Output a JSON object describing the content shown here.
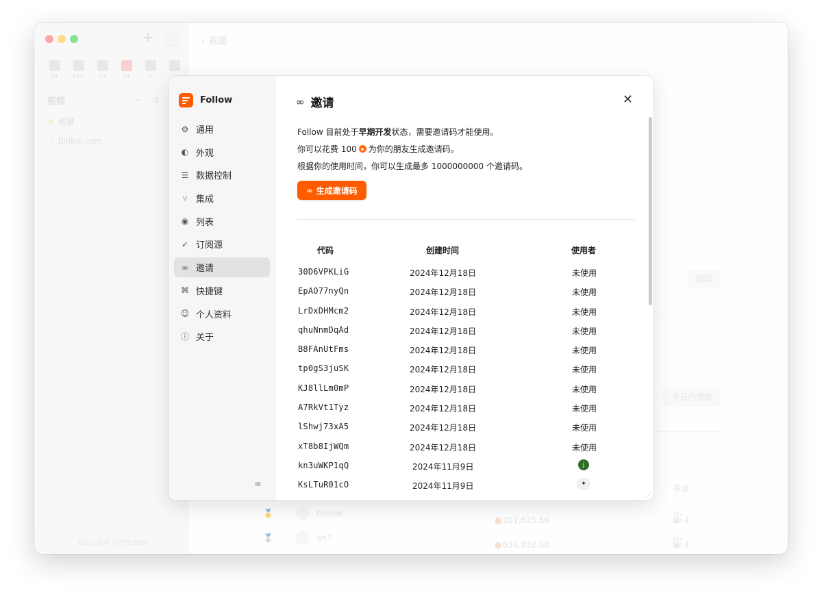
{
  "app": {
    "new_button": "+",
    "categories": [
      {
        "icon": "article-icon",
        "count": "34"
      },
      {
        "icon": "twitter-icon",
        "count": "99+"
      },
      {
        "icon": "picture-icon",
        "count": "17"
      },
      {
        "icon": "video-icon",
        "count": "11"
      },
      {
        "icon": "microphone-icon",
        "count": "0"
      },
      {
        "icon": "megaphone-icon",
        "count": ""
      }
    ],
    "section_title": "视频",
    "section_tools": "⇤ ⇶",
    "favorites": "收藏",
    "feed_group": "Bilibili.com",
    "feed_chevron": "›",
    "version": "Beta 版本 (0732308)"
  },
  "background": {
    "back_label": "返回",
    "withdraw": "提现",
    "claimed_today": "今日已领取",
    "grade_header": "等级",
    "leaderboard": [
      {
        "medal": "🥇",
        "name": "Follow",
        "amount": "1,101,625.56",
        "level": "Lv.4",
        "mult": "36x"
      },
      {
        "medal": "🥈",
        "name": "an7",
        "amount": "1,036,832.60",
        "level": "Lv.4",
        "mult": "36x"
      }
    ]
  },
  "settings": {
    "brand": "Follow",
    "nav": [
      {
        "label": "通用",
        "icon": "⚙",
        "icon_name": "gear-icon",
        "active": false
      },
      {
        "label": "外观",
        "icon": "◐",
        "icon_name": "palette-icon",
        "active": false
      },
      {
        "label": "数据控制",
        "icon": "☰",
        "icon_name": "database-icon",
        "active": false
      },
      {
        "label": "集成",
        "icon": "⑂",
        "icon_name": "integration-icon",
        "active": false
      },
      {
        "label": "列表",
        "icon": "◉",
        "icon_name": "broadcast-icon",
        "active": false
      },
      {
        "label": "订阅源",
        "icon": "✓",
        "icon_name": "feed-check-icon",
        "active": false
      },
      {
        "label": "邀请",
        "icon": "∞",
        "icon_name": "invite-icon",
        "active": true
      },
      {
        "label": "快捷键",
        "icon": "⌘",
        "icon_name": "keyboard-icon",
        "active": false
      },
      {
        "label": "个人资料",
        "icon": "☺",
        "icon_name": "user-icon",
        "active": false
      },
      {
        "label": "关于",
        "icon": "ⓘ",
        "icon_name": "info-icon",
        "active": false
      }
    ],
    "footer_icon": "∞"
  },
  "invite": {
    "title": "邀请",
    "title_icon": "∞",
    "line1_pre": "Follow 目前处于",
    "line1_bold": "早期开发",
    "line1_post": "状态，需要邀请码才能使用。",
    "line2_pre": "你可以花费 100",
    "line2_post": "为你的朋友生成邀请码。",
    "line3": "根据你的使用时间，你可以生成最多 1000000000 个邀请码。",
    "generate_button": "生成邀请码",
    "columns": {
      "code": "代码",
      "created": "创建时间",
      "user": "使用者"
    },
    "rows": [
      {
        "code": "30D6VPKLiG",
        "date": "2024年12月18日",
        "user": "未使用"
      },
      {
        "code": "EpAO77nyQn",
        "date": "2024年12月18日",
        "user": "未使用"
      },
      {
        "code": "LrDxDHMcm2",
        "date": "2024年12月18日",
        "user": "未使用"
      },
      {
        "code": "qhuNnmDqAd",
        "date": "2024年12月18日",
        "user": "未使用"
      },
      {
        "code": "B8FAnUtFms",
        "date": "2024年12月18日",
        "user": "未使用"
      },
      {
        "code": "tp0gS3juSK",
        "date": "2024年12月18日",
        "user": "未使用"
      },
      {
        "code": "KJ8llLm0mP",
        "date": "2024年12月18日",
        "user": "未使用"
      },
      {
        "code": "A7RkVt1Tyz",
        "date": "2024年12月18日",
        "user": "未使用"
      },
      {
        "code": "lShwj73xA5",
        "date": "2024年12月18日",
        "user": "未使用"
      },
      {
        "code": "xT8b8IjWQm",
        "date": "2024年12月18日",
        "user": "未使用"
      },
      {
        "code": "kn3uWKP1qQ",
        "date": "2024年11月9日",
        "avatar": "j",
        "avatar_style": "green"
      },
      {
        "code": "KsLTuR01cO",
        "date": "2024年11月9日",
        "avatar": "✦",
        "avatar_style": "light"
      }
    ]
  },
  "colors": {
    "accent": "#ff5c00",
    "active_nav": "#e2e2e2"
  }
}
